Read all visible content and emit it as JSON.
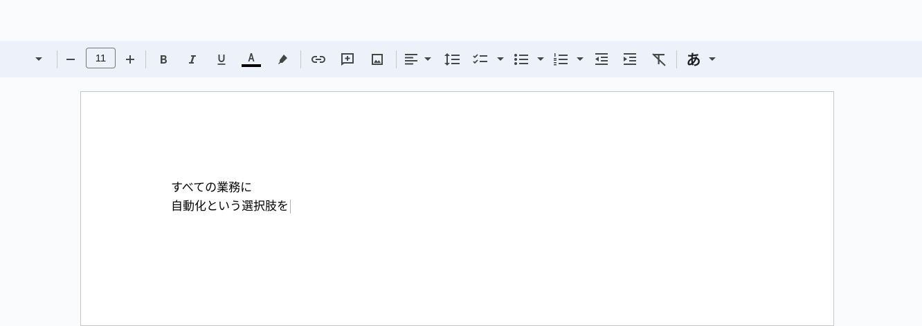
{
  "toolbar": {
    "font_size_value": "11",
    "input_tools_label": "あ",
    "text_color": "#000000",
    "icon_color": "#444746"
  },
  "document": {
    "lines": [
      "すべての業務に",
      "自動化という選択肢を"
    ]
  }
}
